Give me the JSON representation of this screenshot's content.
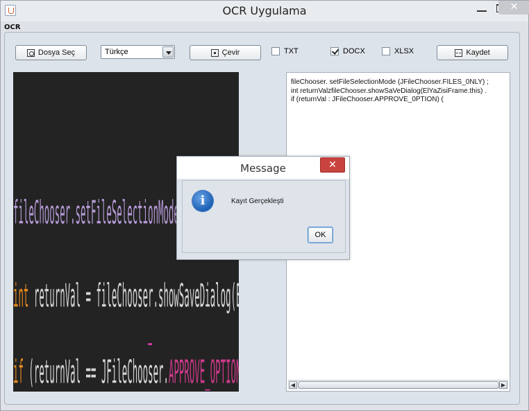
{
  "window": {
    "title": "OCR Uygulama",
    "close_glyph": "✕"
  },
  "menu": {
    "label": "OCR"
  },
  "toolbar": {
    "choose_file_label": "Dosya Seç",
    "language_selected": "Türkçe",
    "translate_label": "Çevir",
    "save_label": "Kaydet",
    "formats": [
      {
        "label": "TXT",
        "checked": false
      },
      {
        "label": "DOCX",
        "checked": true
      },
      {
        "label": "XLSX",
        "checked": false
      }
    ]
  },
  "output": {
    "lines": [
      "fileChooser. setFileSelectionMode (JFileChooser.FILES_0NLY) ;",
      "int returnValzfileChooser.showSaVeDialog(ElYaZisiFrame.this) .",
      "if (returnVal : JFileChooser.APPROVE_0PTION) ("
    ]
  },
  "image": {
    "line1": "fileChooser.setFileSelectionMode(JFileChooser.FILES_ONLY);",
    "line2_kw": "int",
    "line2_rest": " returnVal = fileChooser.showSaveDialog(ElYaziFrame.this);",
    "line3_kw": "if",
    "line3_mid": " (returnVal == JFileChooser.",
    "line3_const": "APPROVE_OPTION",
    "line3_end": ") {"
  },
  "dialog": {
    "title": "Message",
    "close_glyph": "✕",
    "message": "Kayıt Gerçekleşti",
    "ok_label": "OK",
    "icon_glyph": "i"
  },
  "colors": {
    "accent_close": "#c8433f",
    "info_icon": "#1b5fb5"
  }
}
